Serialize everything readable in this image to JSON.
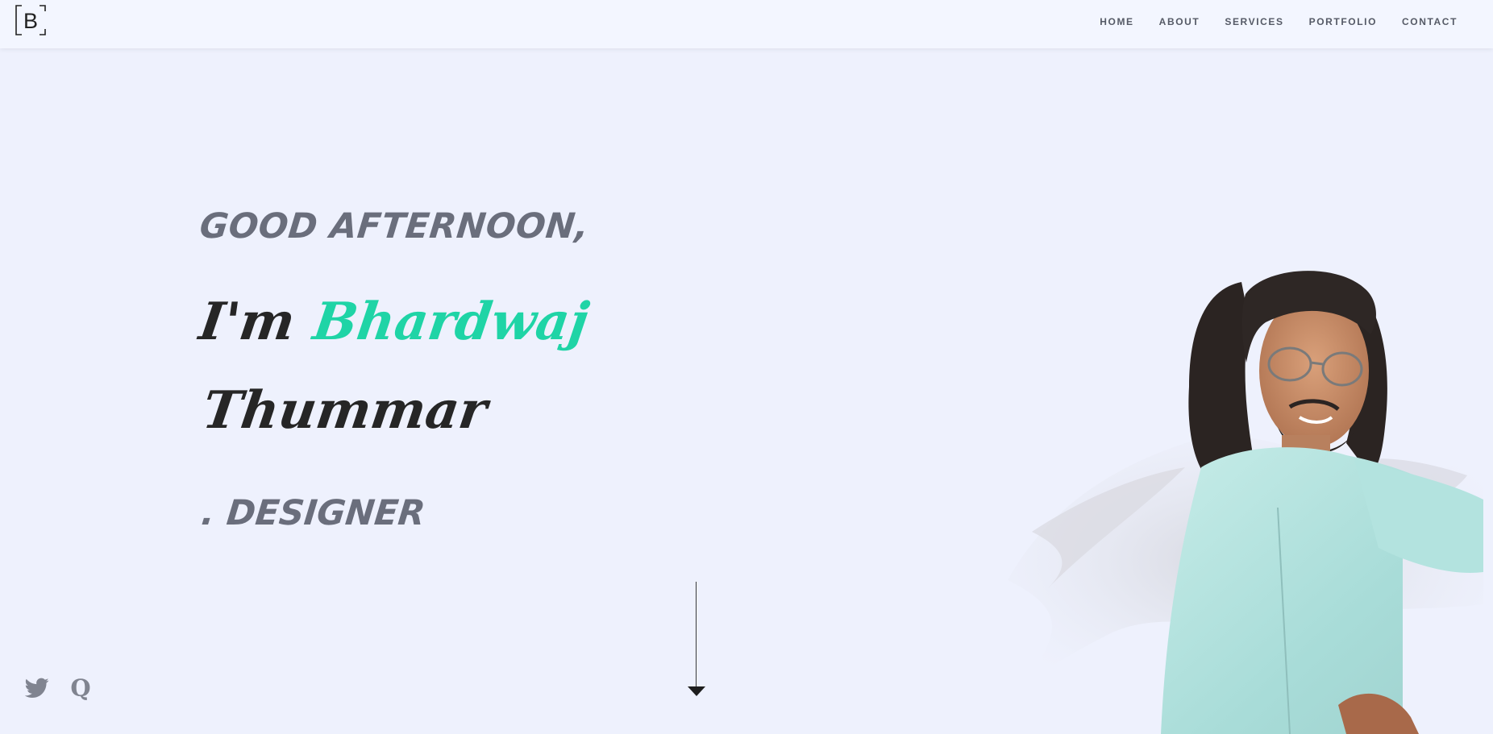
{
  "header": {
    "logo_letter": "B",
    "nav": [
      {
        "label": "HOME"
      },
      {
        "label": "ABOUT"
      },
      {
        "label": "SERVICES"
      },
      {
        "label": "PORTFOLIO"
      },
      {
        "label": "CONTACT"
      }
    ]
  },
  "hero": {
    "greeting": "GOOD AFTERNOON,",
    "im": "I'm",
    "first_name": "Bhardwaj",
    "last_name": "Thummar",
    "role": ". DESIGNER"
  },
  "social": {
    "twitter_icon": "twitter-icon",
    "quora_icon": "quora-icon",
    "quora_letter": "Q"
  },
  "colors": {
    "background": "#eef1fd",
    "header_bg": "#f3f6ff",
    "accent": "#1fd4a6",
    "dark_text": "#262626",
    "muted_text": "#6a6e7c"
  }
}
